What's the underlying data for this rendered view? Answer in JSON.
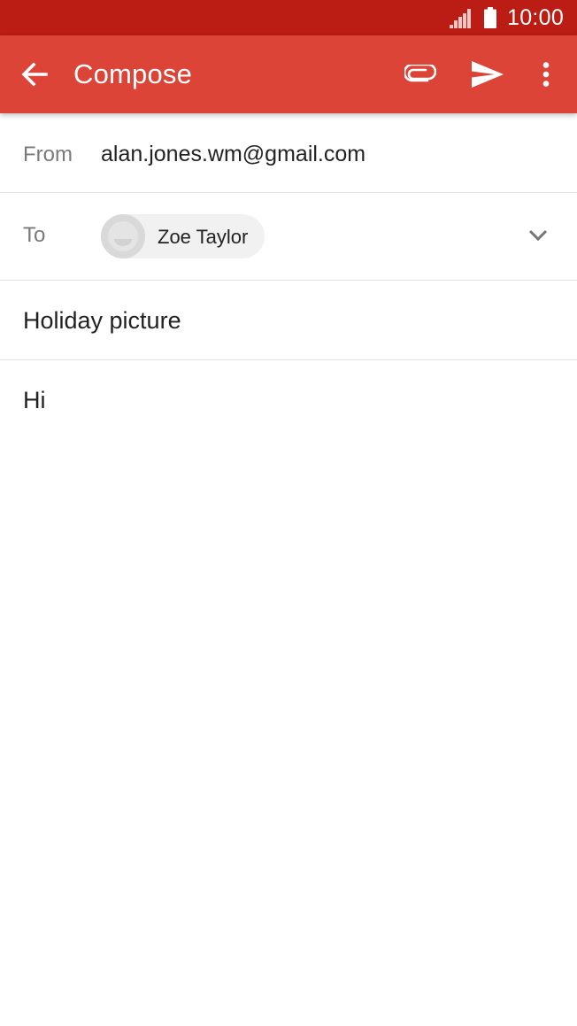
{
  "status_bar": {
    "time": "10:00",
    "background": "#bb1c14"
  },
  "app_bar": {
    "title": "Compose",
    "background": "#db4437",
    "icons": {
      "back": "arrow-back-icon",
      "attach": "paperclip-icon",
      "send": "send-icon",
      "more": "more-vertical-icon"
    }
  },
  "compose": {
    "from_label": "From",
    "from_value": "alan.jones.wm@gmail.com",
    "to_label": "To",
    "recipients": [
      {
        "name": "Zoe Taylor"
      }
    ],
    "subject": "Holiday picture",
    "body": "Hi"
  }
}
